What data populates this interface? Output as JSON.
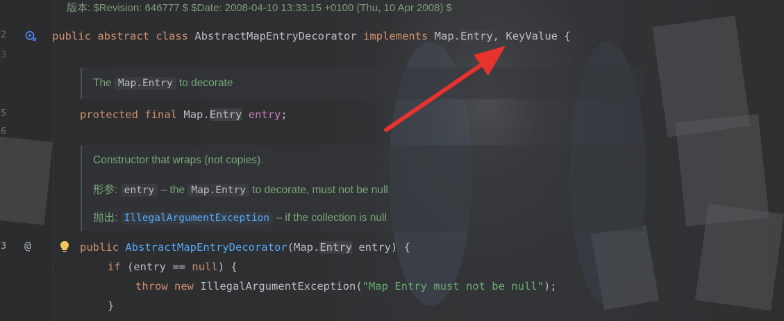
{
  "revision_comment": "版本: $Revision: 646777 $ $Date: 2008-04-10 13:33:15 +0100 (Thu, 10 Apr 2008) $",
  "line_numbers": [
    "2",
    "3",
    "5",
    "6",
    "3"
  ],
  "class_decl": {
    "public": "public",
    "abstract": "abstract",
    "class": "class",
    "name": "AbstractMapEntryDecorator",
    "implements": "implements",
    "iface1_prefix": "Map.",
    "iface1_hl": "Entry",
    "sep": ",",
    "iface2": "KeyValue",
    "brace": "{"
  },
  "doc1": {
    "text_pre": "The",
    "chip": "Map.Entry",
    "text_post": "to decorate"
  },
  "field_decl": {
    "protected": "protected",
    "final": "final",
    "type_prefix": "Map.",
    "type_hl": "Entry",
    "name": "entry",
    "semi": ";"
  },
  "doc2": {
    "summary": "Constructor that wraps (not copies).",
    "param_tag": "形参:",
    "param_name": "entry",
    "param_dash": "– the",
    "param_chip": "Map.Entry",
    "param_post": "to decorate, must not be null",
    "throws_tag": "抛出:",
    "throws_chip": "IllegalArgumentException",
    "throws_post": "– if the collection is null"
  },
  "ctor_decl": {
    "public": "public",
    "name": "AbstractMapEntryDecorator",
    "open": "(",
    "ptype_prefix": "Map.",
    "ptype_hl": "Entry",
    "pname": "entry",
    "close": ") {"
  },
  "if_line": {
    "kw": "if",
    "open": "(entry ==",
    "null": "null",
    "close": ") {"
  },
  "throw_line": {
    "throw": "throw",
    "new": "new",
    "type": "IllegalArgumentException(",
    "msg": "\"Map Entry must not be null\"",
    "close": ");"
  },
  "close_brace": "}",
  "colors": {
    "keyword": "#cf8e6d",
    "field": "#c77dbb",
    "function": "#56a8f5",
    "string": "#6aab73",
    "doc": "#78a677",
    "arrow": "#e8322d"
  },
  "icons": [
    "implemented-interface-icon",
    "at-annotation-icon",
    "lightbulb-icon",
    "red-arrow-annotation"
  ]
}
